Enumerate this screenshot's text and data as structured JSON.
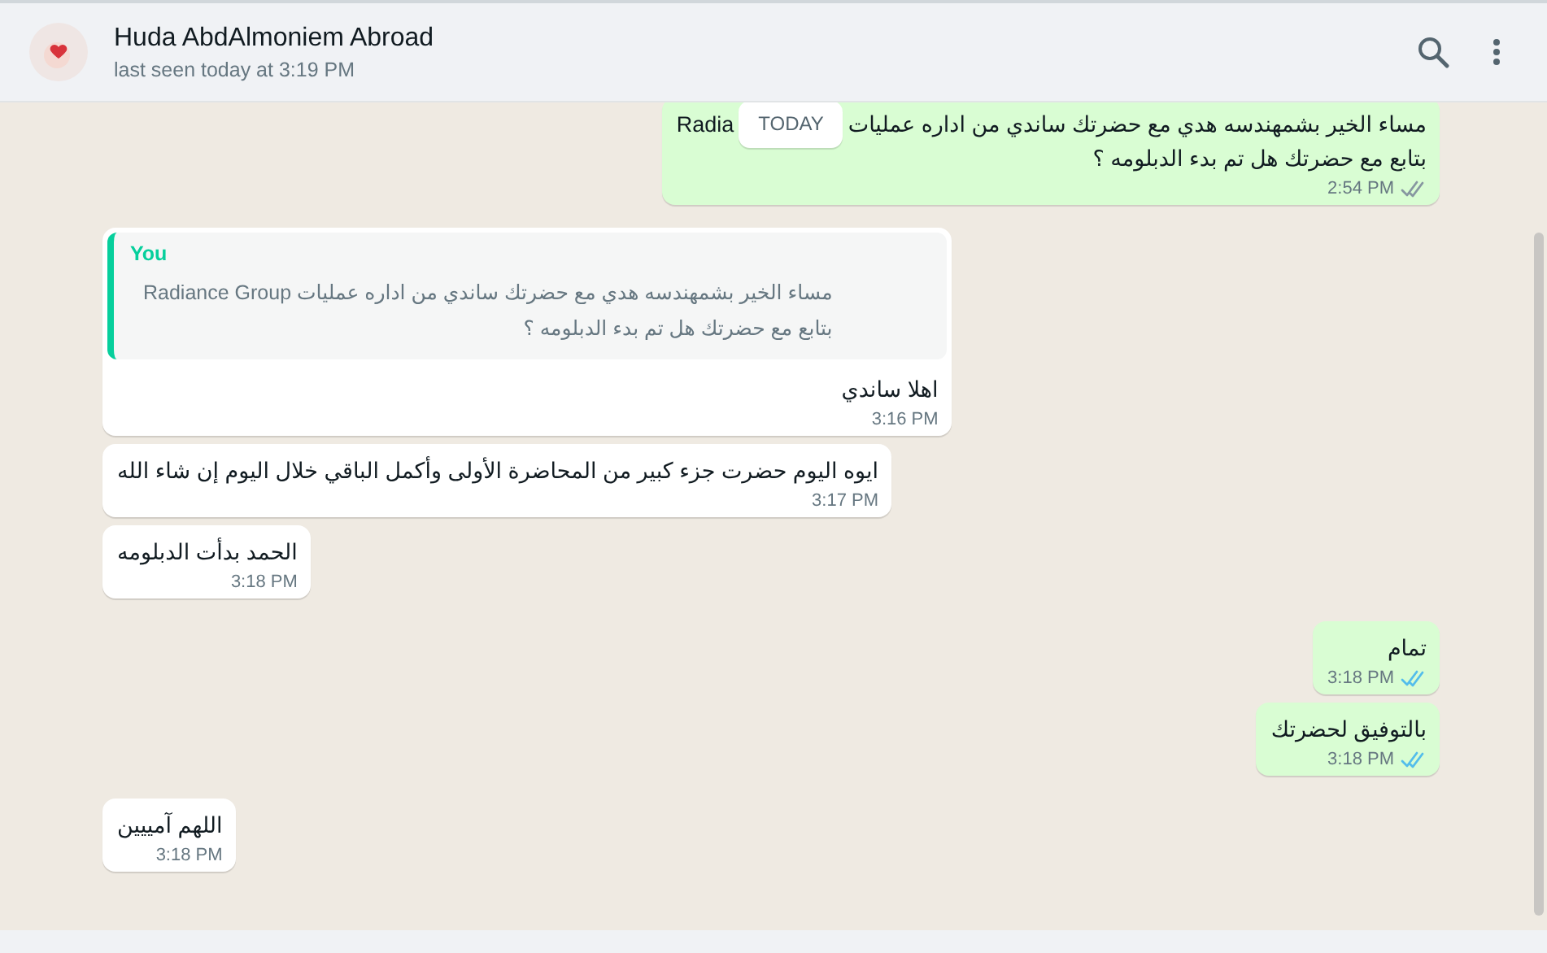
{
  "header": {
    "name": "Huda AbdAlmoniem Abroad",
    "status": "last seen today at 3:19 PM"
  },
  "date_badge": "TODAY",
  "messages": [
    {
      "kind": "out",
      "lines": [
        [
          "مساء الخير بشمهندسه هدي مع حضرتك ساندي من اداره عمليات",
          "Radia"
        ],
        [
          "بتابع مع حضرتك هل تم بدء الدبلومه ؟"
        ]
      ],
      "time": "2:54 PM",
      "read": false
    },
    {
      "kind": "in",
      "quote": {
        "author": "You",
        "lines": [
          "مساء الخير بشمهندسه هدي مع حضرتك ساندي من اداره عمليات Radiance Group",
          "بتابع مع حضرتك هل تم بدء الدبلومه ؟"
        ]
      },
      "lines": [
        [
          "اهلا ساندي"
        ]
      ],
      "time": "3:16 PM"
    },
    {
      "kind": "in",
      "lines": [
        [
          "ايوه اليوم حضرت جزء كبير من  المحاضرة الأولى وأكمل الباقي خلال اليوم إن شاء الله"
        ]
      ],
      "time": "3:17 PM"
    },
    {
      "kind": "in",
      "lines": [
        [
          "الحمد بدأت الدبلومه"
        ]
      ],
      "time": "3:18 PM"
    },
    {
      "kind": "out",
      "lines": [
        [
          "تمام"
        ]
      ],
      "time": "3:18 PM",
      "read": true
    },
    {
      "kind": "out",
      "lines": [
        [
          "بالتوفيق لحضرتك"
        ]
      ],
      "time": "3:18 PM",
      "read": true
    },
    {
      "kind": "in",
      "lines": [
        [
          "اللهم آمييين"
        ]
      ],
      "time": "3:18 PM"
    }
  ]
}
